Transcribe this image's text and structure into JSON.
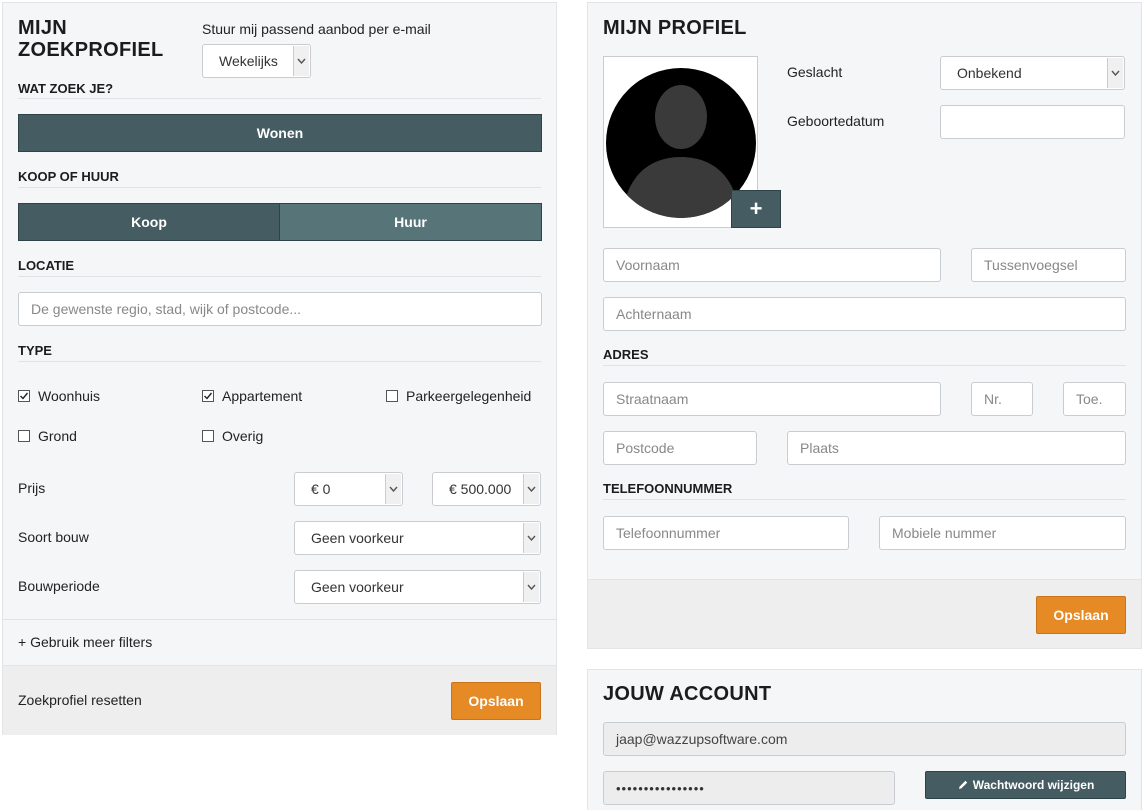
{
  "zoekprofiel": {
    "title_line1": "MIJN",
    "title_line2": "ZOEKPROFIEL",
    "email_label": "Stuur mij passend aanbod per e-mail",
    "email_frequency": "Wekelijks",
    "wat_zoek_je": "WAT ZOEK JE?",
    "wonen_button": "Wonen",
    "koop_of_huur": "KOOP OF HUUR",
    "koop_button": "Koop",
    "huur_button": "Huur",
    "locatie": "LOCATIE",
    "locatie_placeholder": "De gewenste regio, stad, wijk of postcode...",
    "type": "TYPE",
    "types": [
      {
        "label": "Woonhuis",
        "checked": true
      },
      {
        "label": "Appartement",
        "checked": true
      },
      {
        "label": "Parkeergelegenheid",
        "checked": false
      },
      {
        "label": "Grond",
        "checked": false
      },
      {
        "label": "Overig",
        "checked": false
      }
    ],
    "prijs_label": "Prijs",
    "prijs_min": "€ 0",
    "prijs_max": "€ 500.000",
    "soort_bouw_label": "Soort bouw",
    "soort_bouw_value": "Geen voorkeur",
    "bouwperiode_label": "Bouwperiode",
    "bouwperiode_value": "Geen voorkeur",
    "meer_filters": "+ Gebruik meer filters",
    "reset": "Zoekprofiel resetten",
    "opslaan": "Opslaan"
  },
  "profiel": {
    "title": "MIJN PROFIEL",
    "geslacht_label": "Geslacht",
    "geslacht_value": "Onbekend",
    "geboortedatum_label": "Geboortedatum",
    "geboortedatum_value": "",
    "voornaam_placeholder": "Voornaam",
    "tussenvoegsel_placeholder": "Tussenvoegsel",
    "achternaam_placeholder": "Achternaam",
    "adres": "ADRES",
    "straatnaam_placeholder": "Straatnaam",
    "nr_placeholder": "Nr.",
    "toe_placeholder": "Toe.",
    "postcode_placeholder": "Postcode",
    "plaats_placeholder": "Plaats",
    "telefoonnummer_section": "TELEFOONNUMMER",
    "telefoon_placeholder": "Telefoonnummer",
    "mobiel_placeholder": "Mobiele nummer",
    "opslaan": "Opslaan",
    "add_photo": "+"
  },
  "account": {
    "title": "JOUW ACCOUNT",
    "email": "jaap@wazzupsoftware.com",
    "password_mask": "••••••••••••••••",
    "change_password": "Wachtwoord wijzigen"
  },
  "colors": {
    "dark_button": "#455d62",
    "mid_button": "#577579",
    "accent": "#e58a25"
  }
}
